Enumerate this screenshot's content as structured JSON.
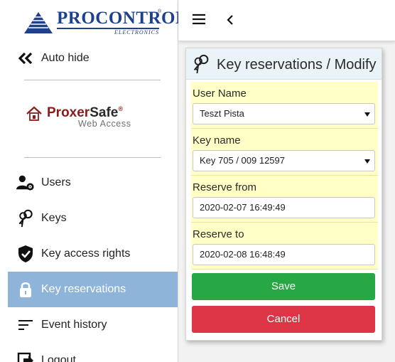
{
  "logo": {
    "brand": "PROCONTROL",
    "registered": "®",
    "sub": "ELECTRONICS"
  },
  "sidebar": {
    "auto_hide": {
      "label": "Auto hide",
      "icon": "double-chevron-left-icon"
    },
    "app_logo": {
      "title_a": "Proxer",
      "title_b": "Safe",
      "registered": "®",
      "subtitle": "Web Access"
    },
    "items": [
      {
        "label": "Users",
        "icon": "users-gear-icon"
      },
      {
        "label": "Keys",
        "icon": "keys-icon"
      },
      {
        "label": "Key access rights",
        "icon": "shield-check-icon"
      },
      {
        "label": "Key reservations",
        "icon": "lock-icon",
        "active": true
      },
      {
        "label": "Event history",
        "icon": "list-lines-icon"
      },
      {
        "label": "Logout",
        "icon": "logout-icon"
      }
    ]
  },
  "topbar": {
    "menu_icon": "hamburger-icon",
    "back_icon": "chevron-left-icon"
  },
  "form": {
    "title": "Key reservations / Modify",
    "header_icon": "keys-icon",
    "user_name": {
      "label": "User Name",
      "value": "Teszt Pista"
    },
    "key_name": {
      "label": "Key name",
      "value": "Key 705 / 009 12597"
    },
    "reserve_from": {
      "label": "Reserve from",
      "value": "2020-02-07 16:49:49"
    },
    "reserve_to": {
      "label": "Reserve to",
      "value": "2020-02-08 16:48:49"
    },
    "save_label": "Save",
    "cancel_label": "Cancel"
  },
  "colors": {
    "brand_blue": "#1f3f8f",
    "active_nav": "#8eb4da",
    "form_field_bg": "#ffffc6",
    "save": "#28a745",
    "cancel": "#dc3545",
    "header_bg": "#eaf3f8"
  }
}
